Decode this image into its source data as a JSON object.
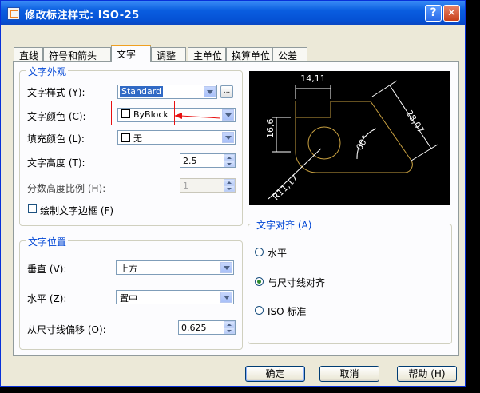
{
  "window": {
    "title": "修改标注样式: ISO-25",
    "help_glyph": "?",
    "close_glyph": "✕"
  },
  "tabs": [
    "直线",
    "符号和箭头",
    "文字",
    "调整",
    "主单位",
    "换算单位",
    "公差"
  ],
  "active_tab": 2,
  "text_appearance": {
    "group_title": "文字外观",
    "style_label": "文字样式 (Y):",
    "style_value": "Standard",
    "style_btn": "...",
    "color_label": "文字颜色 (C):",
    "color_value": "ByBlock",
    "fill_label": "填充颜色 (L):",
    "fill_value": "无",
    "height_label": "文字高度 (T):",
    "height_value": "2.5",
    "fraction_label": "分数高度比例 (H):",
    "fraction_value": "1",
    "frame_label": "绘制文字边框 (F)",
    "frame_checked": false
  },
  "text_placement": {
    "group_title": "文字位置",
    "vertical_label": "垂直 (V):",
    "vertical_value": "上方",
    "horizontal_label": "水平 (Z):",
    "horizontal_value": "置中",
    "offset_label": "从尺寸线偏移 (O):",
    "offset_value": "0.625"
  },
  "text_alignment": {
    "group_title": "文字对齐 (A)",
    "options": [
      "水平",
      "与尺寸线对齐",
      "ISO 标准"
    ],
    "selected": 1
  },
  "preview": {
    "dims": [
      "14,11",
      "16,6",
      "28,07",
      "60°",
      "R11,17"
    ],
    "line_color": "#c8a040",
    "text_color": "#ffffff"
  },
  "footer": {
    "ok": "确定",
    "cancel": "取消",
    "help": "帮助 (H)"
  },
  "annotation": {
    "arrow_color": "#e81010"
  }
}
